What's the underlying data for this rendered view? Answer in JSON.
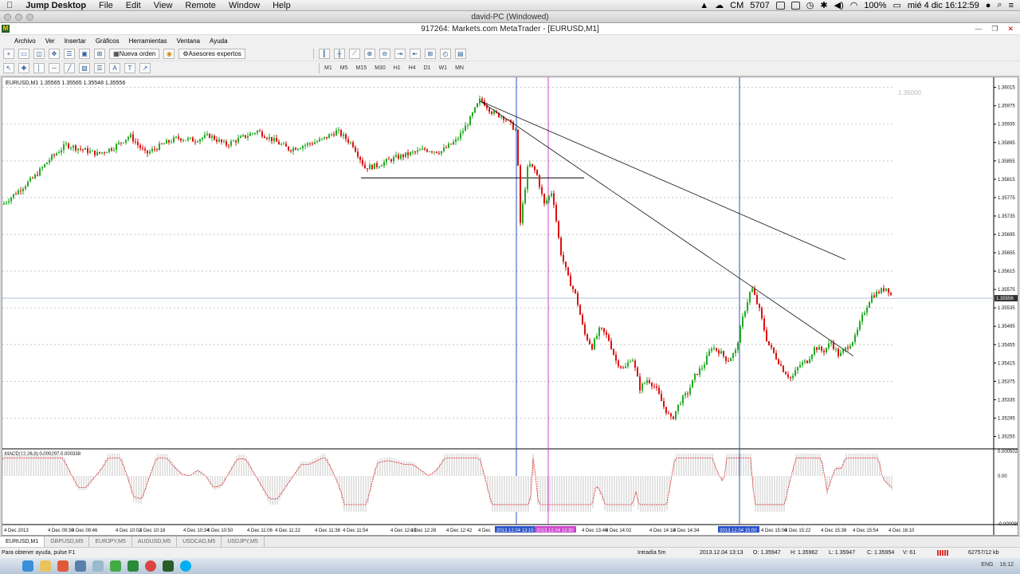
{
  "mac_menu": {
    "app": "Jump Desktop",
    "items": [
      "File",
      "Edit",
      "View",
      "Remote",
      "Window",
      "Help"
    ],
    "status_text": "CM",
    "status_num": "5707",
    "battery": "100%",
    "datetime": "mié 4 dic  16:12:59"
  },
  "window_title": "david-PC (Windowed)",
  "mt_title": "917264: Markets.com MetaTrader - [EURUSD,M1]",
  "mt_menu": [
    "Archivo",
    "Ver",
    "Insertar",
    "Gráficos",
    "Herramientas",
    "Ventana",
    "Ayuda"
  ],
  "toolbar": {
    "new_order": "Nueva orden",
    "experts": "Asesores expertos",
    "timeframes": [
      "M1",
      "M5",
      "M15",
      "M30",
      "H1",
      "H4",
      "D1",
      "W1",
      "MN"
    ]
  },
  "chart_data": {
    "type": "candlestick",
    "title": "EURUSD,M1  1.35565 1.35565 1.35548 1.35556",
    "price_label_top": "1.36000",
    "current_price": "1.35556",
    "ylim": [
      1.35235,
      1.3603
    ],
    "y_ticks": [
      1.36015,
      1.35975,
      1.35935,
      1.35895,
      1.35855,
      1.35815,
      1.35775,
      1.35735,
      1.35695,
      1.35655,
      1.35615,
      1.35575,
      1.35535,
      1.35495,
      1.35455,
      1.35415,
      1.35375,
      1.35335,
      1.35295,
      1.35255
    ],
    "y_tick_labels": [
      "1.36015",
      "1.35975",
      "1.35935",
      "1.35895",
      "1.35855",
      "1.35815",
      "1.35775",
      "1.35735",
      "1.35695",
      "1.35655",
      "1.35615",
      "1.35575",
      "1.35535",
      "1.35495",
      "1.35455",
      "1.35415",
      "1.35375",
      "1.35335",
      "1.35295",
      "1.35255"
    ],
    "close_path": [
      [
        0,
        1.3576
      ],
      [
        20,
        1.3579
      ],
      [
        40,
        1.3582
      ],
      [
        60,
        1.3586
      ],
      [
        80,
        1.3589
      ],
      [
        100,
        1.3588
      ],
      [
        120,
        1.3587
      ],
      [
        140,
        1.35885
      ],
      [
        160,
        1.3591
      ],
      [
        180,
        1.3587
      ],
      [
        200,
        1.3589
      ],
      [
        220,
        1.35905
      ],
      [
        240,
        1.359
      ],
      [
        260,
        1.3591
      ],
      [
        280,
        1.3589
      ],
      [
        300,
        1.35905
      ],
      [
        320,
        1.3592
      ],
      [
        340,
        1.359
      ],
      [
        360,
        1.3588
      ],
      [
        380,
        1.3589
      ],
      [
        400,
        1.359
      ],
      [
        420,
        1.3592
      ],
      [
        440,
        1.3589
      ],
      [
        455,
        1.3584
      ],
      [
        470,
        1.35845
      ],
      [
        490,
        1.3586
      ],
      [
        510,
        1.3587
      ],
      [
        530,
        1.3588
      ],
      [
        550,
        1.35875
      ],
      [
        570,
        1.359
      ],
      [
        585,
        1.3594
      ],
      [
        600,
        1.3599
      ],
      [
        615,
        1.3596
      ],
      [
        630,
        1.3595
      ],
      [
        645,
        1.3592
      ],
      [
        650,
        1.3572
      ],
      [
        660,
        1.3585
      ],
      [
        670,
        1.3583
      ],
      [
        680,
        1.3576
      ],
      [
        690,
        1.3579
      ],
      [
        700,
        1.3566
      ],
      [
        710,
        1.356
      ],
      [
        720,
        1.3556
      ],
      [
        730,
        1.3548
      ],
      [
        740,
        1.3545
      ],
      [
        750,
        1.3549
      ],
      [
        760,
        1.3547
      ],
      [
        770,
        1.3542
      ],
      [
        780,
        1.354
      ],
      [
        790,
        1.3543
      ],
      [
        800,
        1.3536
      ],
      [
        810,
        1.3538
      ],
      [
        820,
        1.3536
      ],
      [
        830,
        1.3532
      ],
      [
        840,
        1.3529
      ],
      [
        850,
        1.3533
      ],
      [
        860,
        1.3535
      ],
      [
        870,
        1.3539
      ],
      [
        880,
        1.3541
      ],
      [
        890,
        1.3545
      ],
      [
        900,
        1.3544
      ],
      [
        910,
        1.3542
      ],
      [
        920,
        1.3544
      ],
      [
        930,
        1.3552
      ],
      [
        940,
        1.3558
      ],
      [
        950,
        1.3553
      ],
      [
        960,
        1.3546
      ],
      [
        970,
        1.3543
      ],
      [
        980,
        1.354
      ],
      [
        990,
        1.3538
      ],
      [
        1000,
        1.3541
      ],
      [
        1010,
        1.3542
      ],
      [
        1020,
        1.3545
      ],
      [
        1030,
        1.3544
      ],
      [
        1040,
        1.3546
      ],
      [
        1050,
        1.3543
      ],
      [
        1060,
        1.3545
      ],
      [
        1070,
        1.3547
      ],
      [
        1080,
        1.3552
      ],
      [
        1090,
        1.3556
      ],
      [
        1100,
        1.3557
      ],
      [
        1110,
        1.3558
      ],
      [
        1117,
        1.35556
      ]
    ],
    "hline_price": 1.35818,
    "vlines": [
      {
        "x": 645,
        "color": "#2850c8"
      },
      {
        "x": 685,
        "color": "#cc44cc"
      },
      {
        "x": 925,
        "color": "#2850c8"
      }
    ],
    "trendlines": [
      [
        [
          600,
          1.35985
        ],
        [
          1058,
          1.3564
        ]
      ],
      [
        [
          600,
          1.35985
        ],
        [
          1068,
          1.3543
        ]
      ]
    ],
    "macd_label": "MACD(12,26,9) 0.000297 0.000338",
    "macd_ticks": [
      "0.000502",
      "0.00",
      "-0.000098"
    ],
    "x_labels": [
      "4 Dec 2013",
      "4 Dec 09:30",
      "4 Dec 09:46",
      "4 Dec 10:02",
      "4 Dec 10:18",
      "4 Dec 10:34",
      "4 Dec 10:50",
      "4 Dec 11:06",
      "4 Dec 11:22",
      "4 Dec 11:38",
      "4 Dec 11:54",
      "4 Dec 12:10",
      "4 Dec 12:26",
      "4 Dec 12:42",
      "4 Dec",
      "2013.12.04 13:15",
      "2013.12.04 13:30",
      "4 Dec 13:46",
      "4 Dec 14:02",
      "4 Dec 14:18",
      "4 Dec 14:34",
      "2013.12.04 15:00",
      "4 Dec 15:06",
      "4 Dec 15:22",
      "4 Dec 15:38",
      "4 Dec 15:54",
      "4 Dec 16:10"
    ]
  },
  "tabs": [
    "EURUSD,M1",
    "GBPUSD,M5",
    "EURJPY,M5",
    "AUDUSD,M5",
    "USDCAD,M5",
    "USDJPY,M5"
  ],
  "status": {
    "help": "Para obtener ayuda, pulse F1",
    "profile": "Intradía 5m",
    "time": "2013.12.04 13:13",
    "open": "O: 1.35947",
    "high": "H: 1.35962",
    "low": "L: 1.35947",
    "close": "C: 1.35954",
    "volume": "V: 61",
    "traffic": "62757/12 kb"
  },
  "taskbar": {
    "lang": "ENG",
    "clock": "16:12"
  }
}
